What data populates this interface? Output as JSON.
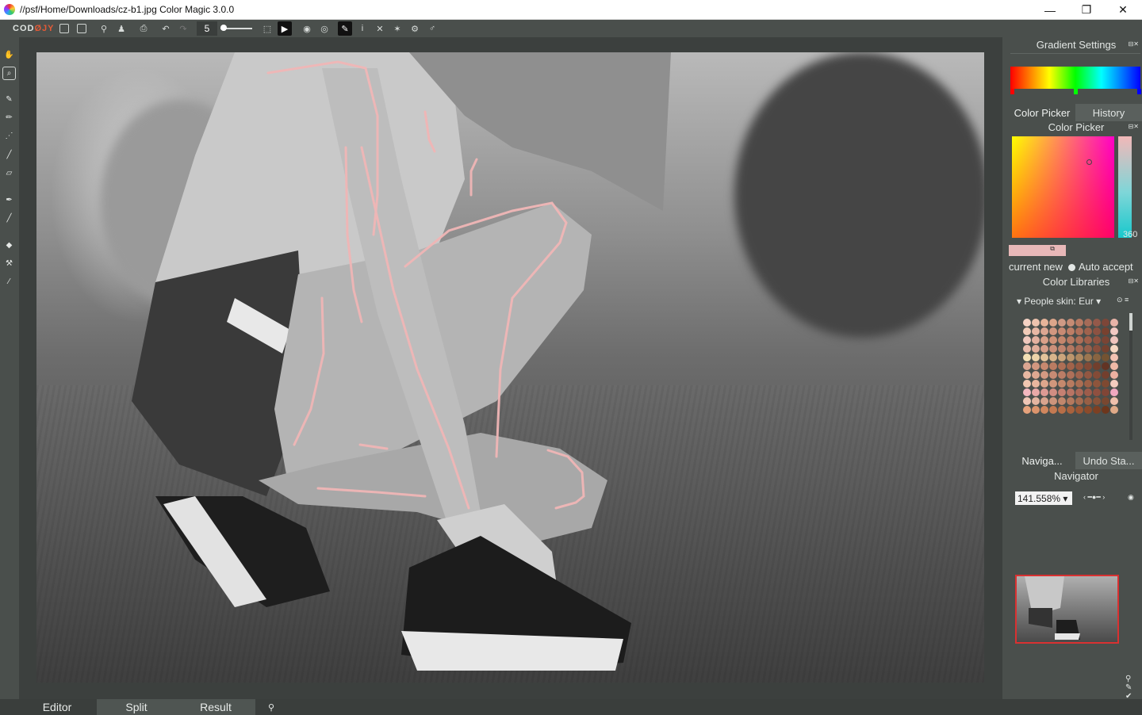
{
  "window": {
    "title": "//psf/Home/Downloads/cz-b1.jpg Color Magic 3.0.0",
    "minimize": "—",
    "maximize": "❐",
    "close": "✕"
  },
  "toolbar": {
    "logo_left": "COD",
    "logo_accent": "ØJY",
    "brush_size": "5",
    "icons": [
      "import-icon",
      "export-icon",
      "filter-icon",
      "stamp-icon",
      "print-icon",
      "undo-icon",
      "redo-icon",
      "select-icon",
      "play-icon",
      "eye-icon",
      "hide-icon",
      "pen-icon",
      "info-icon",
      "move-icon",
      "star-icon",
      "settings-icon",
      "link-icon"
    ]
  },
  "tools": [
    "hand-icon",
    "zoom-icon",
    "brush-icon",
    "pencil-icon",
    "dotted-brush-icon",
    "line-icon",
    "eraser-icon",
    "dropper-icon",
    "smudge-icon",
    "fill-icon",
    "clone-icon",
    "picker-icon"
  ],
  "right_panel": {
    "gradient_settings": "Gradient Settings",
    "tab_color_picker": "Color Picker",
    "tab_history": "History",
    "color_picker_title": "Color Picker",
    "current_new": "current new",
    "auto_accept": "Auto accept",
    "color_libraries": "Color Libraries",
    "library_name": "People skin: Eur",
    "tab_navigator": "Naviga...",
    "tab_undo": "Undo Sta...",
    "navigator_title": "Navigator",
    "zoom": "141.558%",
    "gradient_colors": [
      "#ff0000",
      "#ffff00",
      "#00ff00",
      "#00ffff",
      "#0000ff"
    ],
    "hue_value_text": "360"
  },
  "skin_swatches": [
    "#f5d2c4",
    "#eec3ae",
    "#e6b49a",
    "#dca58a",
    "#cf9a85",
    "#c58b74",
    "#b87a63",
    "#a56b58",
    "#94594a",
    "#7d4638",
    "#e8b3a8",
    "#f1cbb8",
    "#e7b7a4",
    "#dca692",
    "#d19780",
    "#c88a73",
    "#be7e66",
    "#b0705a",
    "#9f624d",
    "#8c5242",
    "#78412f",
    "#f3c9c3",
    "#f0c8bd",
    "#e3b09f",
    "#d9a089",
    "#cf9278",
    "#c4866c",
    "#b97a62",
    "#ad6e57",
    "#a0604b",
    "#8f5240",
    "#7a4434",
    "#efc4bd",
    "#e9bcab",
    "#e0ad9a",
    "#d69e89",
    "#cb907a",
    "#bf846e",
    "#b37862",
    "#a66a55",
    "#98604c",
    "#884f3d",
    "#75412f",
    "#f5d7c2",
    "#f3e0b5",
    "#ecd3a9",
    "#e3c39a",
    "#d8b48b",
    "#cba57c",
    "#bc966d",
    "#ad875f",
    "#9b7650",
    "#886441",
    "#745332",
    "#f2c2b2",
    "#dca691",
    "#d2977f",
    "#c7896f",
    "#bb7c62",
    "#ae6f55",
    "#a1634a",
    "#935740",
    "#834a36",
    "#723f2d",
    "#623424",
    "#f0b9a6",
    "#e9b8a2",
    "#dea891",
    "#d39982",
    "#c78b74",
    "#bb7d66",
    "#ae7059",
    "#a0634d",
    "#925742",
    "#834b37",
    "#733f2e",
    "#edb0a0",
    "#f2c7b1",
    "#e8b69e",
    "#dda68c",
    "#d1977c",
    "#c5896d",
    "#b87b60",
    "#ab6e53",
    "#9d6147",
    "#8e553c",
    "#7e4931",
    "#f3ccbf",
    "#f4b8c0",
    "#e9a9a8",
    "#dd9a94",
    "#d18d82",
    "#c58072",
    "#b87464",
    "#ab6857",
    "#9d5c4b",
    "#8f5040",
    "#804536",
    "#f0a8c0",
    "#efc6b6",
    "#e4b5a1",
    "#d9a48e",
    "#cd957c",
    "#c1876c",
    "#b4795e",
    "#a66c51",
    "#985f45",
    "#89533a",
    "#794730",
    "#efc0ac",
    "#e6a27c",
    "#dc946c",
    "#d1875e",
    "#c47a52",
    "#b76e47",
    "#a9623d",
    "#9b5634",
    "#8c4b2b",
    "#7d4023",
    "#6d361c",
    "#e0aa88"
  ]
}
